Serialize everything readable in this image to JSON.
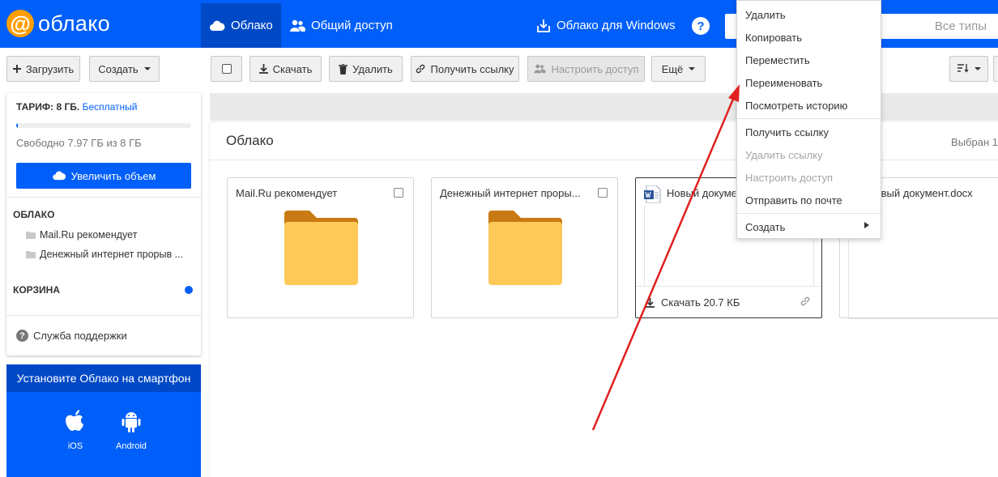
{
  "header": {
    "logo_at": "@",
    "logo_text": "облако",
    "tabs": [
      {
        "label": "Облако",
        "icon": "cloud-icon"
      },
      {
        "label": "Общий доступ",
        "icon": "users-icon"
      }
    ],
    "windows_link": "Облако для Windows",
    "help_label": "?",
    "search_filter": "Все типы"
  },
  "left_controls": {
    "upload_label": "Загрузить",
    "create_label": "Создать"
  },
  "sidebar": {
    "tariff_label": "ТАРИФ: 8 ГБ.",
    "tariff_plan": "Бесплатный",
    "quota_fraction": 0.004,
    "quota_text": "Свободно 7.97 ГБ из 8 ГБ",
    "grow_label": "Увеличить объем",
    "cloud_section": "ОБЛАКО",
    "tree": [
      "Mail.Ru рекомендует",
      "Денежный интернет прорыв ..."
    ],
    "trash_section": "КОРЗИНА",
    "support_label": "Служба поддержки",
    "help_glyph": "?"
  },
  "promo": {
    "title": "Установите Облако на смартфон",
    "apps": [
      "iOS",
      "Android"
    ]
  },
  "toolbar": {
    "download_label": "Скачать",
    "delete_label": "Удалить",
    "get_link_label": "Получить ссылку",
    "access_label": "Настроить доступ",
    "more_label": "Ещё"
  },
  "panel": {
    "title": "Облако",
    "selected_text": "Выбран 1"
  },
  "cards": [
    {
      "name": "Mail.Ru рекомендует",
      "type": "folder"
    },
    {
      "name": "Денежный интернет проры...",
      "type": "folder"
    },
    {
      "name": "Новый документ.docx",
      "type": "docx",
      "download_text": "Скачать 20.7 КБ"
    },
    {
      "name": "Новый документ.docx",
      "type": "docx"
    }
  ],
  "context_menu": {
    "items": [
      {
        "label": "Удалить",
        "disabled": false
      },
      {
        "label": "Копировать",
        "disabled": false
      },
      {
        "label": "Переместить",
        "disabled": false
      },
      {
        "label": "Переименовать",
        "disabled": false
      },
      {
        "label": "Посмотреть историю",
        "disabled": false
      },
      {
        "label": "Получить ссылку",
        "disabled": false
      },
      {
        "label": "Удалить ссылку",
        "disabled": true
      },
      {
        "label": "Настроить доступ",
        "disabled": true
      },
      {
        "label": "Отправить по почте",
        "disabled": false
      },
      {
        "label": "Создать",
        "disabled": false
      }
    ]
  },
  "colors": {
    "brand_blue": "#005ff9",
    "brand_blue_dark": "#0049c6",
    "logo_orange": "#ff9e00",
    "folder_yellow": "#ffc95a",
    "folder_tab": "#c97a12",
    "annotation_red": "#e02020"
  }
}
